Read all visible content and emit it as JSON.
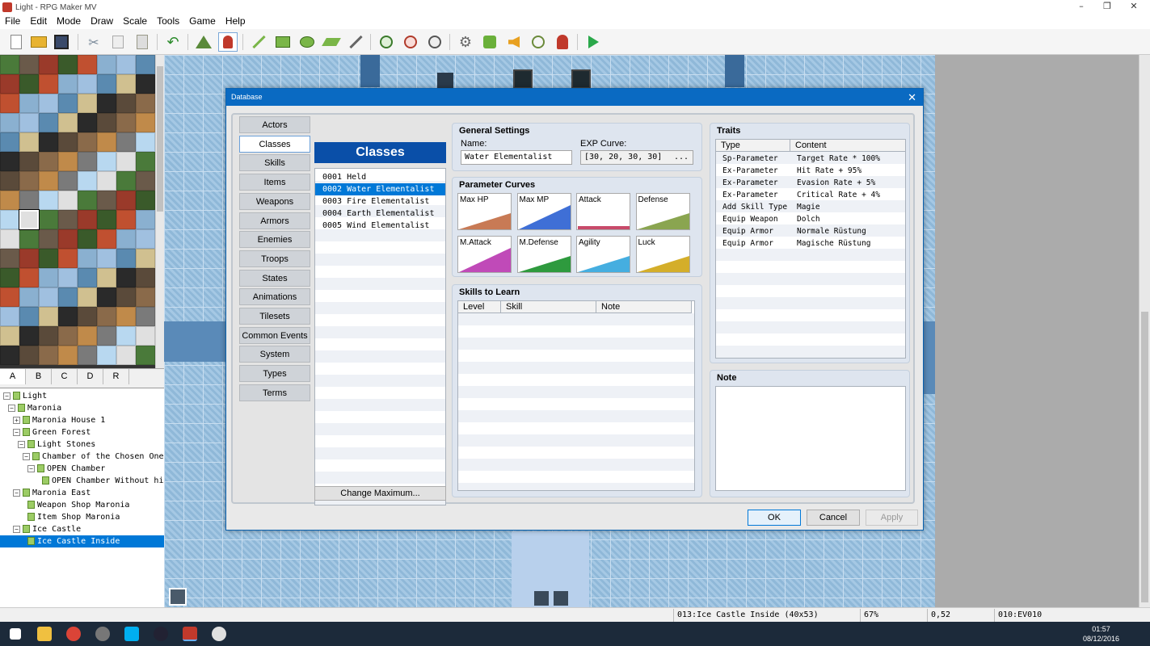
{
  "window": {
    "title": "Light - RPG Maker MV",
    "controls": [
      "–",
      "❐",
      "✕"
    ]
  },
  "menu": [
    "File",
    "Edit",
    "Mode",
    "Draw",
    "Scale",
    "Tools",
    "Game",
    "Help"
  ],
  "tile_tabs": [
    "A",
    "B",
    "C",
    "D",
    "R"
  ],
  "map_tree": [
    {
      "label": "Light",
      "level": 0,
      "expander": "⊟"
    },
    {
      "label": "Maronia",
      "level": 1,
      "expander": "⊟"
    },
    {
      "label": "Maronia House 1",
      "level": 2,
      "expander": "⊞"
    },
    {
      "label": "Green Forest",
      "level": 2,
      "expander": "⊟"
    },
    {
      "label": "Light Stones",
      "level": 3,
      "expander": "⊟"
    },
    {
      "label": "Chamber of the Chosen One",
      "level": 4,
      "expander": "⊟"
    },
    {
      "label": "OPEN Chamber",
      "level": 5,
      "expander": "⊟"
    },
    {
      "label": "OPEN Chamber Without him",
      "level": 6,
      "expander": ""
    },
    {
      "label": "Maronia East",
      "level": 2,
      "expander": "⊟"
    },
    {
      "label": "Weapon Shop Maronia",
      "level": 3,
      "expander": ""
    },
    {
      "label": "Item Shop Maronia",
      "level": 3,
      "expander": ""
    },
    {
      "label": "Ice Castle",
      "level": 2,
      "expander": "⊟"
    },
    {
      "label": "Ice Castle Inside",
      "level": 3,
      "expander": "",
      "selected": true
    }
  ],
  "status": {
    "map": "013:Ice Castle Inside (40x53)",
    "zoom": "67%",
    "coords": "0,52",
    "event": "010:EV010"
  },
  "clock": {
    "time": "01:57",
    "date": "08/12/2016"
  },
  "database": {
    "title": "Database",
    "close": "✕",
    "categories": [
      "Actors",
      "Classes",
      "Skills",
      "Items",
      "Weapons",
      "Armors",
      "Enemies",
      "Troops",
      "States",
      "Animations",
      "Tilesets",
      "Common Events",
      "System",
      "Types",
      "Terms"
    ],
    "active_category": "Classes",
    "list_title": "Classes",
    "classes": [
      "0001 Held",
      "0002 Water Elementalist",
      "0003 Fire Elementalist",
      "0004 Earth Elementalist",
      "0005 Wind Elementalist"
    ],
    "selected_class": 1,
    "change_max": "Change Maximum...",
    "general": {
      "title": "General Settings",
      "name_label": "Name:",
      "name_value": "Water Elementalist",
      "exp_label": "EXP Curve:",
      "exp_value": "[30, 20, 30, 30]",
      "exp_button": "..."
    },
    "curves": {
      "title": "Parameter Curves",
      "items": [
        {
          "label": "Max HP",
          "color": "#c87a55",
          "shape": "rise"
        },
        {
          "label": "Max MP",
          "color": "#3f6fd6",
          "shape": "steep"
        },
        {
          "label": "Attack",
          "color": "#c84a6a",
          "shape": "flat"
        },
        {
          "label": "Defense",
          "color": "#8aa550",
          "shape": "rise"
        },
        {
          "label": "M.Attack",
          "color": "#c04ab8",
          "shape": "steep"
        },
        {
          "label": "M.Defense",
          "color": "#2e9a3e",
          "shape": "rise"
        },
        {
          "label": "Agility",
          "color": "#45aee0",
          "shape": "rise"
        },
        {
          "label": "Luck",
          "color": "#d4ae2a",
          "shape": "rise"
        }
      ]
    },
    "skills": {
      "title": "Skills to Learn",
      "columns": [
        "Level",
        "Skill",
        "Note"
      ]
    },
    "traits": {
      "title": "Traits",
      "columns": [
        "Type",
        "Content"
      ],
      "rows": [
        {
          "type": "Sp-Parameter",
          "content": "Target Rate * 100%"
        },
        {
          "type": "Ex-Parameter",
          "content": "Hit Rate + 95%"
        },
        {
          "type": "Ex-Parameter",
          "content": "Evasion Rate + 5%"
        },
        {
          "type": "Ex-Parameter",
          "content": "Critical Rate + 4%"
        },
        {
          "type": "Add Skill Type",
          "content": "Magie"
        },
        {
          "type": "Equip Weapon",
          "content": "Dolch"
        },
        {
          "type": "Equip Armor",
          "content": "Normale Rüstung"
        },
        {
          "type": "Equip Armor",
          "content": "Magische Rüstung"
        }
      ]
    },
    "note": {
      "title": "Note"
    },
    "buttons": {
      "ok": "OK",
      "cancel": "Cancel",
      "apply": "Apply"
    }
  }
}
